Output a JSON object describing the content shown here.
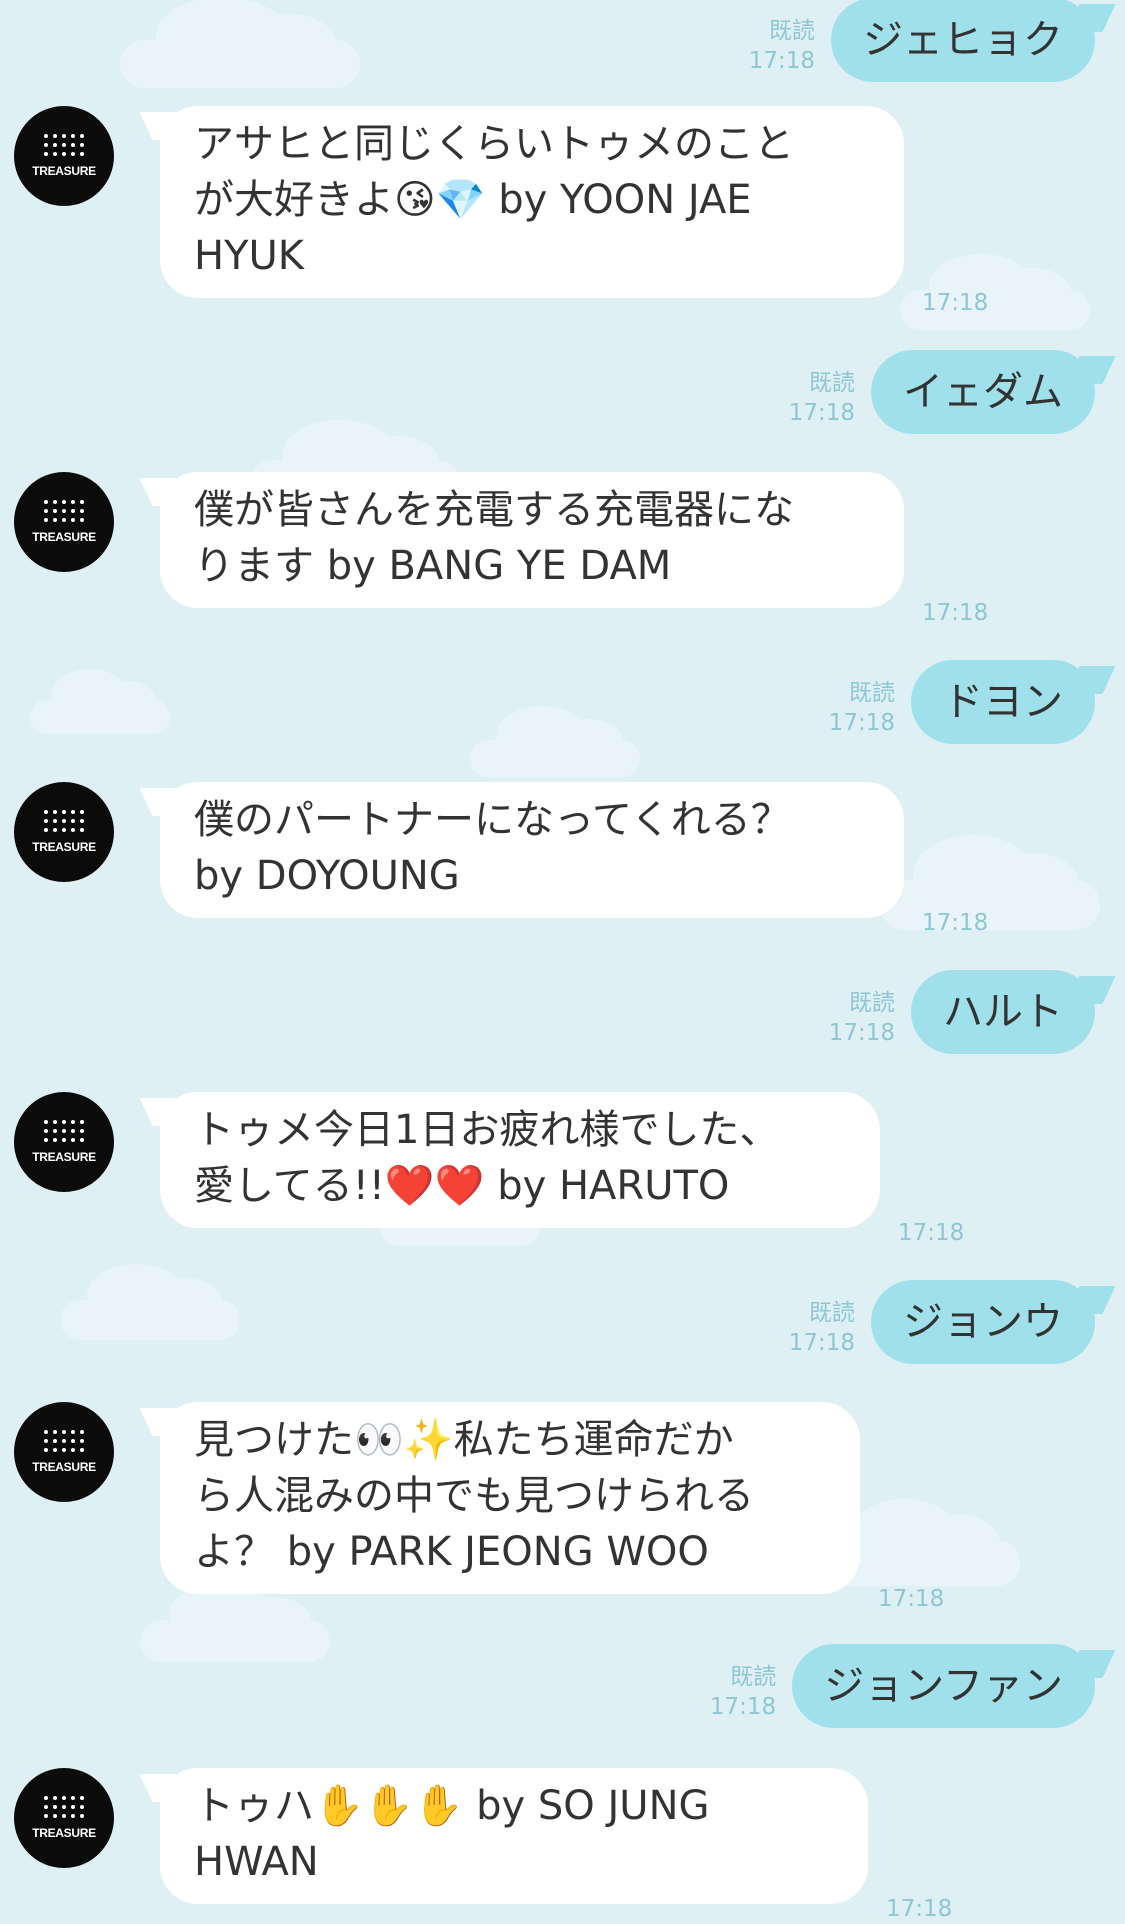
{
  "chat": {
    "read_label": "既読",
    "messages": [
      {
        "side": "sent",
        "text": "ジェヒョク",
        "time": "17:18"
      },
      {
        "side": "received",
        "avatar_label": "TREASURE",
        "lines": [
          "アサヒと同じくらいトゥメのこと",
          "が大好きよ😘💎 by YOON JAE",
          "HYUK"
        ],
        "time": "17:18"
      },
      {
        "side": "sent",
        "text": "イェダム",
        "time": "17:18"
      },
      {
        "side": "received",
        "avatar_label": "TREASURE",
        "lines": [
          "僕が皆さんを充電する充電器にな",
          "ります by BANG YE DAM"
        ],
        "time": "17:18"
      },
      {
        "side": "sent",
        "text": "ドヨン",
        "time": "17:18"
      },
      {
        "side": "received",
        "avatar_label": "TREASURE",
        "lines": [
          "僕のパートナーになってくれる？",
          "by DOYOUNG"
        ],
        "time": "17:18"
      },
      {
        "side": "sent",
        "text": "ハルト",
        "time": "17:18"
      },
      {
        "side": "received",
        "avatar_label": "TREASURE",
        "lines": [
          "トゥメ今日1日お疲れ様でした、",
          "愛してる!!❤️❤️ by HARUTO"
        ],
        "time": "17:18"
      },
      {
        "side": "sent",
        "text": "ジョンウ",
        "time": "17:18"
      },
      {
        "side": "received",
        "avatar_label": "TREASURE",
        "lines": [
          "見つけた👀✨私たち運命だか",
          "ら人混みの中でも見つけられる",
          "よ？ by PARK JEONG WOO"
        ],
        "time": "17:18"
      },
      {
        "side": "sent",
        "text": "ジョンファン",
        "time": "17:18"
      },
      {
        "side": "received",
        "avatar_label": "TREASURE",
        "lines": [
          "トゥハ✋✋✋ by SO JUNG",
          "HWAN"
        ],
        "time": "17:18"
      }
    ]
  },
  "colors": {
    "background": "#dff0f5",
    "sent_bubble": "#9fe0ea",
    "received_bubble": "#ffffff",
    "meta_text": "#8ec6d4"
  }
}
